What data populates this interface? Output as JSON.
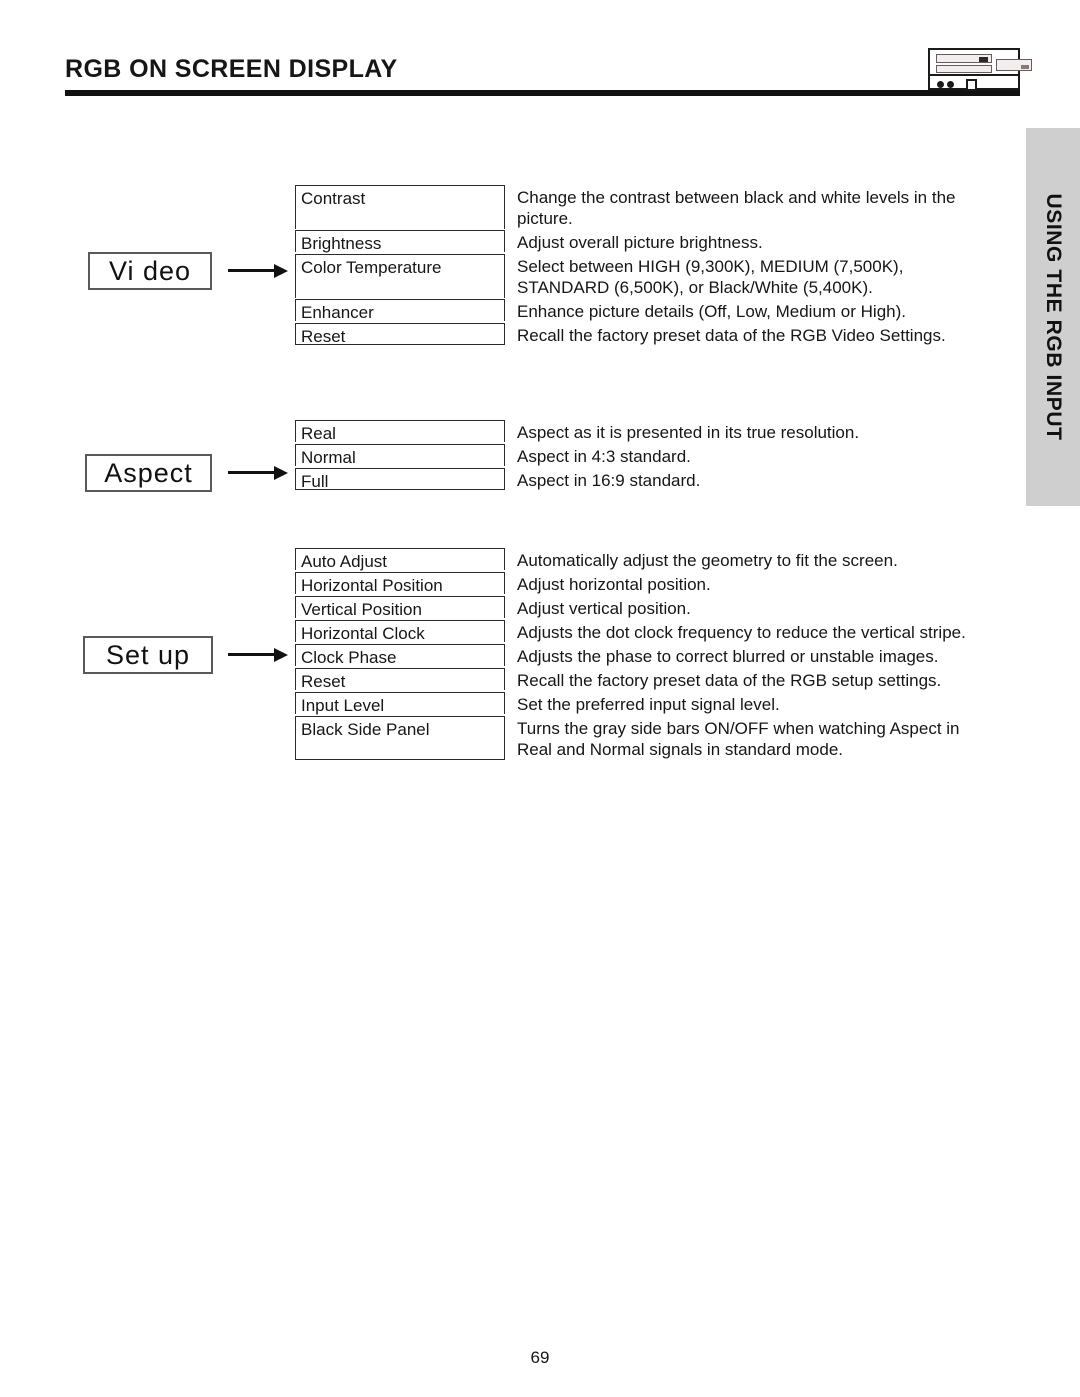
{
  "header": {
    "title": "RGB ON SCREEN DISPLAY",
    "device_icon": "av-receiver-icon"
  },
  "side_tab": {
    "label": "USING THE RGB INPUT",
    "color": "#cfcfcf"
  },
  "page_number": "69",
  "sections": [
    {
      "category": "Vi deo",
      "rows": [
        {
          "name": "Contrast",
          "lines": [
            "Change the contrast between black and white levels in the",
            "picture."
          ]
        },
        {
          "name": "Brightness",
          "lines": [
            "Adjust overall picture brightness."
          ]
        },
        {
          "name": "Color Temperature",
          "lines": [
            "Select between HIGH (9,300K), MEDIUM (7,500K),",
            "STANDARD (6,500K), or Black/White (5,400K)."
          ]
        },
        {
          "name": "Enhancer",
          "lines": [
            "Enhance picture details (Off, Low, Medium or High)."
          ]
        },
        {
          "name": "Reset",
          "lines": [
            "Recall the factory preset data of the RGB Video Settings."
          ]
        }
      ]
    },
    {
      "category": "Aspect",
      "rows": [
        {
          "name": "Real",
          "lines": [
            "Aspect as it is presented in its true resolution."
          ]
        },
        {
          "name": "Normal",
          "lines": [
            "Aspect in 4:3 standard."
          ]
        },
        {
          "name": "Full",
          "lines": [
            "Aspect in 16:9 standard."
          ]
        }
      ]
    },
    {
      "category": "Set up",
      "rows": [
        {
          "name": "Auto Adjust",
          "lines": [
            "Automatically adjust the geometry to fit the screen."
          ]
        },
        {
          "name": "Horizontal Position",
          "lines": [
            "Adjust horizontal position."
          ]
        },
        {
          "name": "Vertical Position",
          "lines": [
            "Adjust vertical position."
          ]
        },
        {
          "name": "Horizontal Clock",
          "lines": [
            "Adjusts the dot clock frequency to reduce the vertical stripe."
          ]
        },
        {
          "name": "Clock Phase",
          "lines": [
            "Adjusts the phase to correct blurred or unstable images."
          ]
        },
        {
          "name": "Reset",
          "lines": [
            "Recall the factory preset data of the RGB setup settings."
          ]
        },
        {
          "name": "Input Level",
          "lines": [
            "Set the preferred input signal level."
          ]
        },
        {
          "name": "Black Side Panel",
          "lines": [
            "Turns the gray side bars ON/OFF when watching Aspect in",
            "Real and Normal signals in standard mode."
          ]
        }
      ]
    }
  ]
}
